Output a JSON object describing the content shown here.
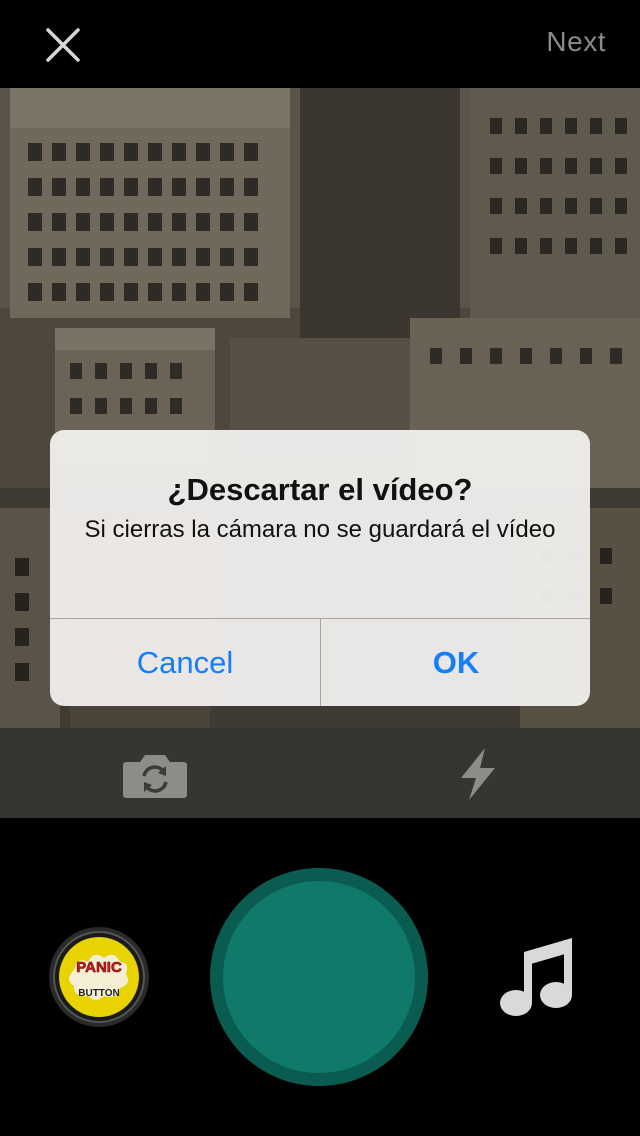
{
  "top_bar": {
    "close_icon": "close-x-icon",
    "next_label": "Next"
  },
  "preview": {
    "content": "camera-preview"
  },
  "controls": {
    "flip_icon": "camera-flip-icon",
    "flash_icon": "flash-bolt-icon"
  },
  "bottom": {
    "sound_button_icon": "panic-button-icon",
    "sound_button_text_top": "PANIC",
    "sound_button_text_bottom": "BUTTON",
    "record_color": "#0f7a69",
    "music_icon": "music-note-icon"
  },
  "alert": {
    "title": "¿Descartar el vídeo?",
    "message": "Si cierras la cámara no se guardará el vídeo",
    "cancel_label": "Cancel",
    "ok_label": "OK",
    "button_color": "#147efb"
  }
}
